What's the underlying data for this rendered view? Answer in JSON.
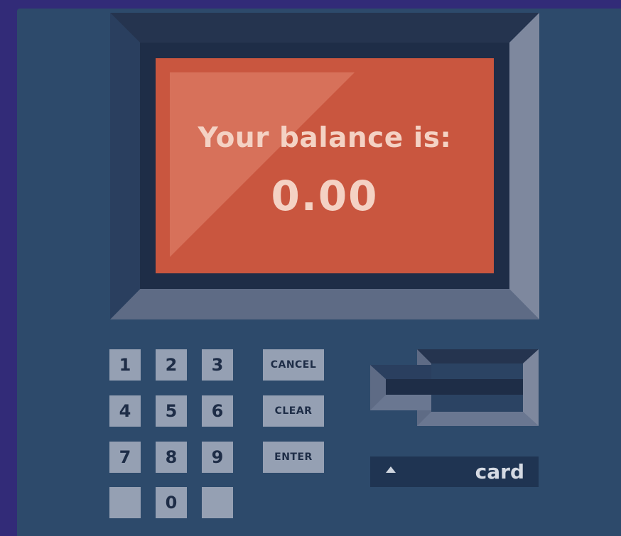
{
  "screen": {
    "balance_label": "Your balance is:",
    "balance_value": "0.00"
  },
  "keypad": {
    "keys": [
      "1",
      "2",
      "3",
      "4",
      "5",
      "6",
      "7",
      "8",
      "9",
      "",
      "0",
      ""
    ],
    "cancel_label": "CANCEL",
    "clear_label": "CLEAR",
    "enter_label": "ENTER"
  },
  "card": {
    "label": "card",
    "arrow_icon": "triangle-up-icon"
  },
  "colors": {
    "background": "#322b78",
    "machine": "#2d4a6b",
    "screen": "#c9563f",
    "key": "#95a0b3"
  }
}
